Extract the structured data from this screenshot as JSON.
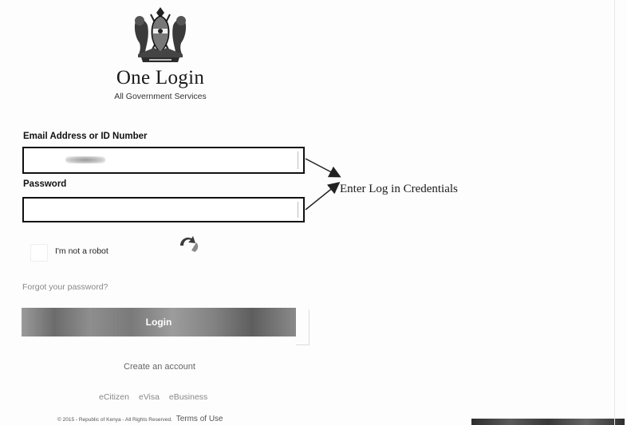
{
  "header": {
    "title": "One Login",
    "subtitle": "All Government Services",
    "logo_icon": "kenya-coat-of-arms-icon"
  },
  "form": {
    "email_label": "Email Address or ID Number",
    "email_value": "",
    "password_label": "Password",
    "password_value": ""
  },
  "annotation": {
    "text": "Enter Log in Credentials"
  },
  "captcha": {
    "label": "I'm not a robot",
    "checked": false,
    "icon": "recaptcha-icon"
  },
  "links": {
    "forgot_password": "Forgot your password?",
    "create_account": "Create an account"
  },
  "login_button": {
    "label": "Login"
  },
  "services": [
    "eCitizen",
    "eVisa",
    "eBusiness"
  ],
  "footer": {
    "copyright": "© 2015 - Republic of Kenya - All Rights Reserved.",
    "terms": "Terms of Use"
  }
}
